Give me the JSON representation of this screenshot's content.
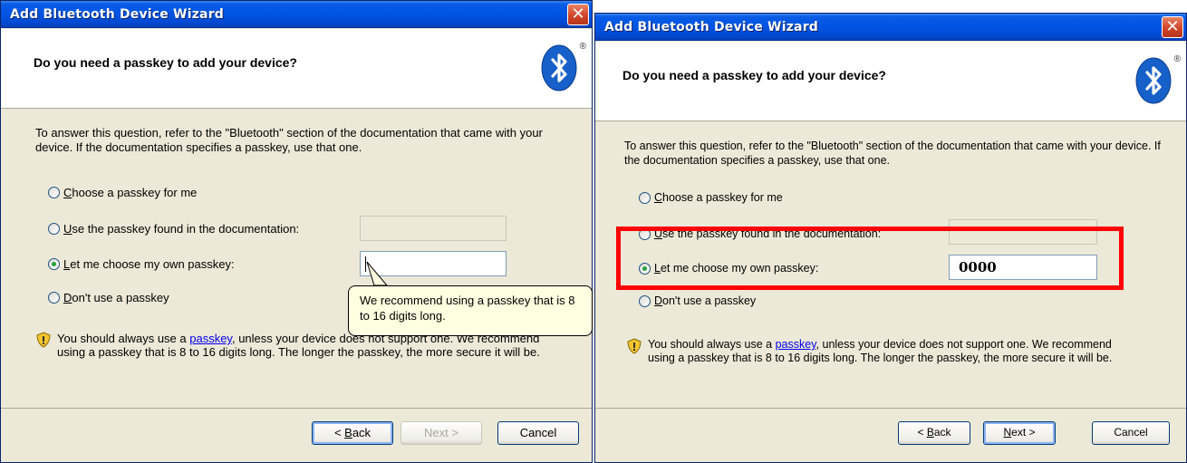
{
  "dialog_left": {
    "title": "Add Bluetooth Device Wizard",
    "header_title": "Do you need a passkey to add your device?",
    "intro": "To answer this question, refer to the \"Bluetooth\" section of the documentation that came with your device. If the documentation specifies a passkey, use that one.",
    "options": [
      {
        "key": "C",
        "rest": "hoose a passkey for me",
        "checked": false
      },
      {
        "key": "U",
        "rest": "se the passkey found in the documentation:",
        "checked": false
      },
      {
        "key": "L",
        "rest": "et me choose my own passkey:",
        "checked": true
      },
      {
        "key": "D",
        "rest": "on't use a passkey",
        "checked": false
      }
    ],
    "passkey_value": "",
    "note_pre": "You should always use a ",
    "note_link": "passkey",
    "note_post": ", unless your device does not support one. We recommend using a passkey that is 8 to 16 digits long. The longer the passkey, the more secure it will be.",
    "tooltip": "We recommend using a passkey that is 8 to 16 digits long.",
    "buttons": {
      "back_pre": "< ",
      "back_key": "B",
      "back_rest": "ack",
      "next": "Next >",
      "cancel": "Cancel"
    }
  },
  "dialog_right": {
    "title": "Add Bluetooth Device Wizard",
    "header_title": "Do you need a passkey to add your device?",
    "intro": "To answer this question, refer to the \"Bluetooth\" section of the documentation that came with your device. If the documentation specifies a passkey, use that one.",
    "options": [
      {
        "key": "C",
        "rest": "hoose a passkey for me",
        "checked": false
      },
      {
        "key": "U",
        "rest": "se the passkey found in the documentation:",
        "checked": false
      },
      {
        "key": "L",
        "rest": "et me choose my own passkey:",
        "checked": true
      },
      {
        "key": "D",
        "rest": "on't use a passkey",
        "checked": false
      }
    ],
    "passkey_value": "0000",
    "note_pre": "You should always use a ",
    "note_link": "passkey",
    "note_post": ", unless your device does not support one. We recommend using a passkey that is 8 to 16 digits long. The longer the passkey, the more secure it will be.",
    "buttons": {
      "back_pre": "< ",
      "back_key": "B",
      "back_rest": "ack",
      "next_key": "N",
      "next_rest": "ext >",
      "cancel": "Cancel"
    }
  },
  "colors": {
    "highlight_box": "#ff0000",
    "titlebar": "#0054e3",
    "tooltip_bg": "#ffffe1"
  }
}
